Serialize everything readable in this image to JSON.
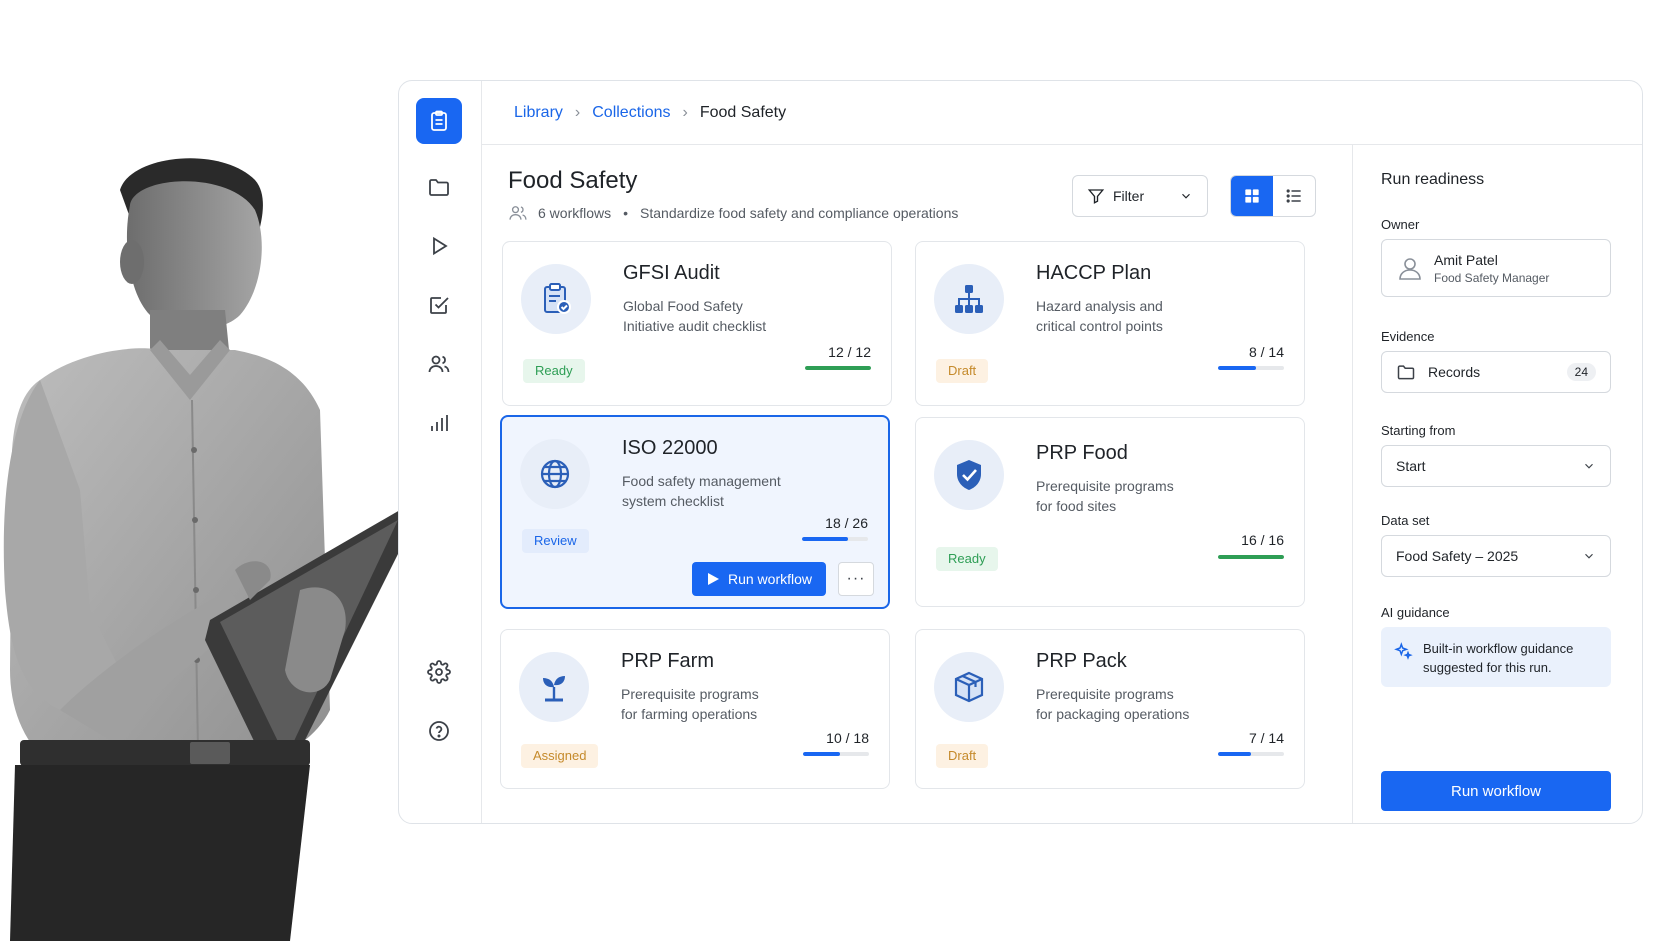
{
  "breadcrumb": {
    "items": [
      "Library",
      "Collections"
    ],
    "current": "Food Safety"
  },
  "header": {
    "title": "Food Safety",
    "count_text": "6 workflows",
    "separator": "•",
    "description": "Standardize food safety and compliance operations"
  },
  "toolbar": {
    "filter_label": "Filter",
    "view_mode": "grid"
  },
  "cards": [
    {
      "title": "GFSI Audit",
      "desc1": "Global Food Safety",
      "desc2": "Initiative audit checklist",
      "status": "Ready",
      "progress": "12 / 12",
      "done": 12,
      "total": 12,
      "bar_color": "#2e9e55",
      "icon": "clipboard-check-icon"
    },
    {
      "title": "HACCP Plan",
      "desc1": "Hazard analysis and",
      "desc2": "critical control points",
      "status": "Draft",
      "progress": "8 / 14",
      "done": 8,
      "total": 14,
      "bar_color": "#1967f2",
      "icon": "hierarchy-icon"
    },
    {
      "title": "ISO 22000",
      "desc1": "Food safety management",
      "desc2": "system checklist",
      "status": "Review",
      "progress": "18 / 26",
      "done": 18,
      "total": 26,
      "bar_color": "#1967f2",
      "icon": "globe-icon",
      "run_label": "Run workflow",
      "more_label": "···"
    },
    {
      "title": "PRP Food",
      "desc1": "Prerequisite programs",
      "desc2": "for food sites",
      "status": "Ready",
      "progress": "16 / 16",
      "done": 16,
      "total": 16,
      "bar_color": "#2e9e55",
      "icon": "shield-check-icon"
    },
    {
      "title": "PRP Farm",
      "desc1": "Prerequisite programs",
      "desc2": "for farming operations",
      "status": "Assigned",
      "progress": "10 / 18",
      "done": 10,
      "total": 18,
      "bar_color": "#1967f2",
      "icon": "sprout-icon"
    },
    {
      "title": "PRP Pack",
      "desc1": "Prerequisite programs",
      "desc2": "for packaging operations",
      "status": "Draft",
      "progress": "7 / 14",
      "done": 7,
      "total": 14,
      "bar_color": "#1967f2",
      "icon": "package-icon"
    }
  ],
  "panel": {
    "title": "Run readiness",
    "owner_label": "Owner",
    "owner_name": "Amit Patel",
    "owner_role": "Food Safety Manager",
    "evidence_label": "Evidence",
    "evidence_value": "Records",
    "evidence_count": "24",
    "starting_label": "Starting from",
    "starting_value": "Start",
    "dataset_label": "Data set",
    "dataset_value": "Food Safety – 2025",
    "ai_label": "AI guidance",
    "ai_text": "Built-in workflow guidance suggested for this run.",
    "run_label": "Run workflow"
  },
  "colors": {
    "accent": "#1967f2",
    "ready": "#2e9e55",
    "draft": "#c58a2b"
  }
}
